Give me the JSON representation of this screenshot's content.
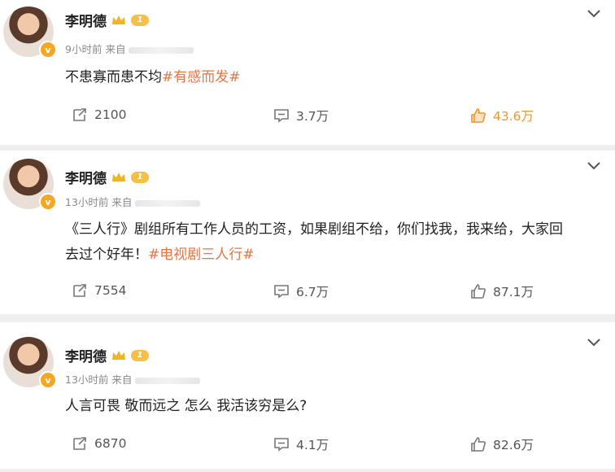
{
  "posts": [
    {
      "author": "李明德",
      "level": "1",
      "time": "9小时前",
      "source_prefix": "来自",
      "text": "不患寡而患不均",
      "topic": "#有感而发#",
      "reposts": "2100",
      "comments": "3.7万",
      "likes": "43.6万",
      "liked": true
    },
    {
      "author": "李明德",
      "level": "1",
      "time": "13小时前",
      "source_prefix": "来自",
      "text_line1": "《三人行》剧组所有工作人员的工资，如果剧组不给，你们找我，我来给，大家回",
      "text_line2": "去过个好年！",
      "topic": "#电视剧三人行#",
      "reposts": "7554",
      "comments": "6.7万",
      "likes": "87.1万",
      "liked": false
    },
    {
      "author": "李明德",
      "level": "1",
      "time": "13小时前",
      "source_prefix": "来自",
      "text": "人言可畏 敬而远之  怎么 我活该穷是么?",
      "reposts": "6870",
      "comments": "4.1万",
      "likes": "82.6万",
      "liked": false
    }
  ],
  "colors": {
    "topic": "#eb7340",
    "liked": "#f0962c",
    "badge": "#f5a623"
  },
  "icons": [
    "avatar",
    "verified-v-badge",
    "crown-icon",
    "level-badge",
    "chevron-down-icon",
    "repost-icon",
    "comment-icon",
    "like-icon"
  ]
}
